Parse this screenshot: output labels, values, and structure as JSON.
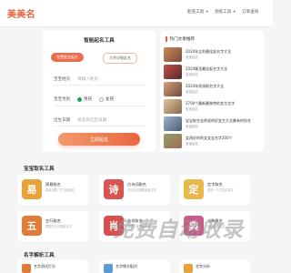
{
  "header": {
    "logo": "美美名",
    "nav": [
      {
        "label": "起名工具"
      },
      {
        "label": "测名工具"
      },
      {
        "label": "订单查询"
      }
    ]
  },
  "form": {
    "title": "智能起名工具",
    "tabs": [
      "免费姓名起名",
      "大师详细起名"
    ],
    "surname_label": "宝宝姓氏",
    "surname_placeholder": "请输入姓氏",
    "gender_label": "宝宝性别",
    "gender_options": [
      "男孩",
      "女孩"
    ],
    "birth_label": "出生日期",
    "birth_placeholder": "请选择出生日期",
    "submit_label": "立即起名"
  },
  "hot": {
    "title": "热门文章推荐",
    "items": [
      {
        "title": "2024年吉利最佳起名字大全",
        "sub": "宝宝起名"
      },
      {
        "title": "2024属龙最佳起名字大全",
        "sub": "宝宝起名"
      },
      {
        "title": "2024年男孩取名字大全",
        "sub": "宝宝起名"
      },
      {
        "title": "2700个最新最独特的女生名字",
        "sub": "宝宝起名"
      },
      {
        "title": "宝宝取名宝库说的好女生大全集有的别名",
        "sub": "宝宝起名"
      },
      {
        "title": "女孩好听的女宝宝名字200个",
        "sub": "宝宝起名"
      }
    ]
  },
  "sections": {
    "baby_tools": "宝宝取名工具",
    "analysis_tools": "名字解析工具"
  },
  "tools": [
    {
      "name": "周易取名",
      "desc": "周易古籍三才五格起名",
      "icon": "易",
      "color": "#e9a13a"
    },
    {
      "name": "古诗词取名",
      "desc": "古诗名句提取宝宝名字",
      "icon": "诗",
      "color": "#d9534f"
    },
    {
      "name": "定字取名",
      "desc": "固定一个字生成名字",
      "icon": "定",
      "color": "#e8b84a"
    },
    {
      "name": "五行取名",
      "desc": "根据五行喜用起名字",
      "icon": "五",
      "color": "#e07b39"
    },
    {
      "name": "生肖取名",
      "desc": "根据生肖属相起名",
      "icon": "肖",
      "color": "#d94f4f"
    },
    {
      "name": "宝典取名",
      "desc": "经典典籍佳名",
      "icon": "典",
      "color": "#c95a89"
    }
  ],
  "analysis": [
    {
      "name": "名字测试打分",
      "color": "#e07b39"
    },
    {
      "name": "名字缘分配对",
      "color": "#5b9bd5"
    },
    {
      "name": "名字分析",
      "color": "#e9a13a"
    }
  ],
  "watermark": "免费自动收录",
  "colors": {
    "accent": "#e8643f",
    "button": "#ec6d4e"
  }
}
